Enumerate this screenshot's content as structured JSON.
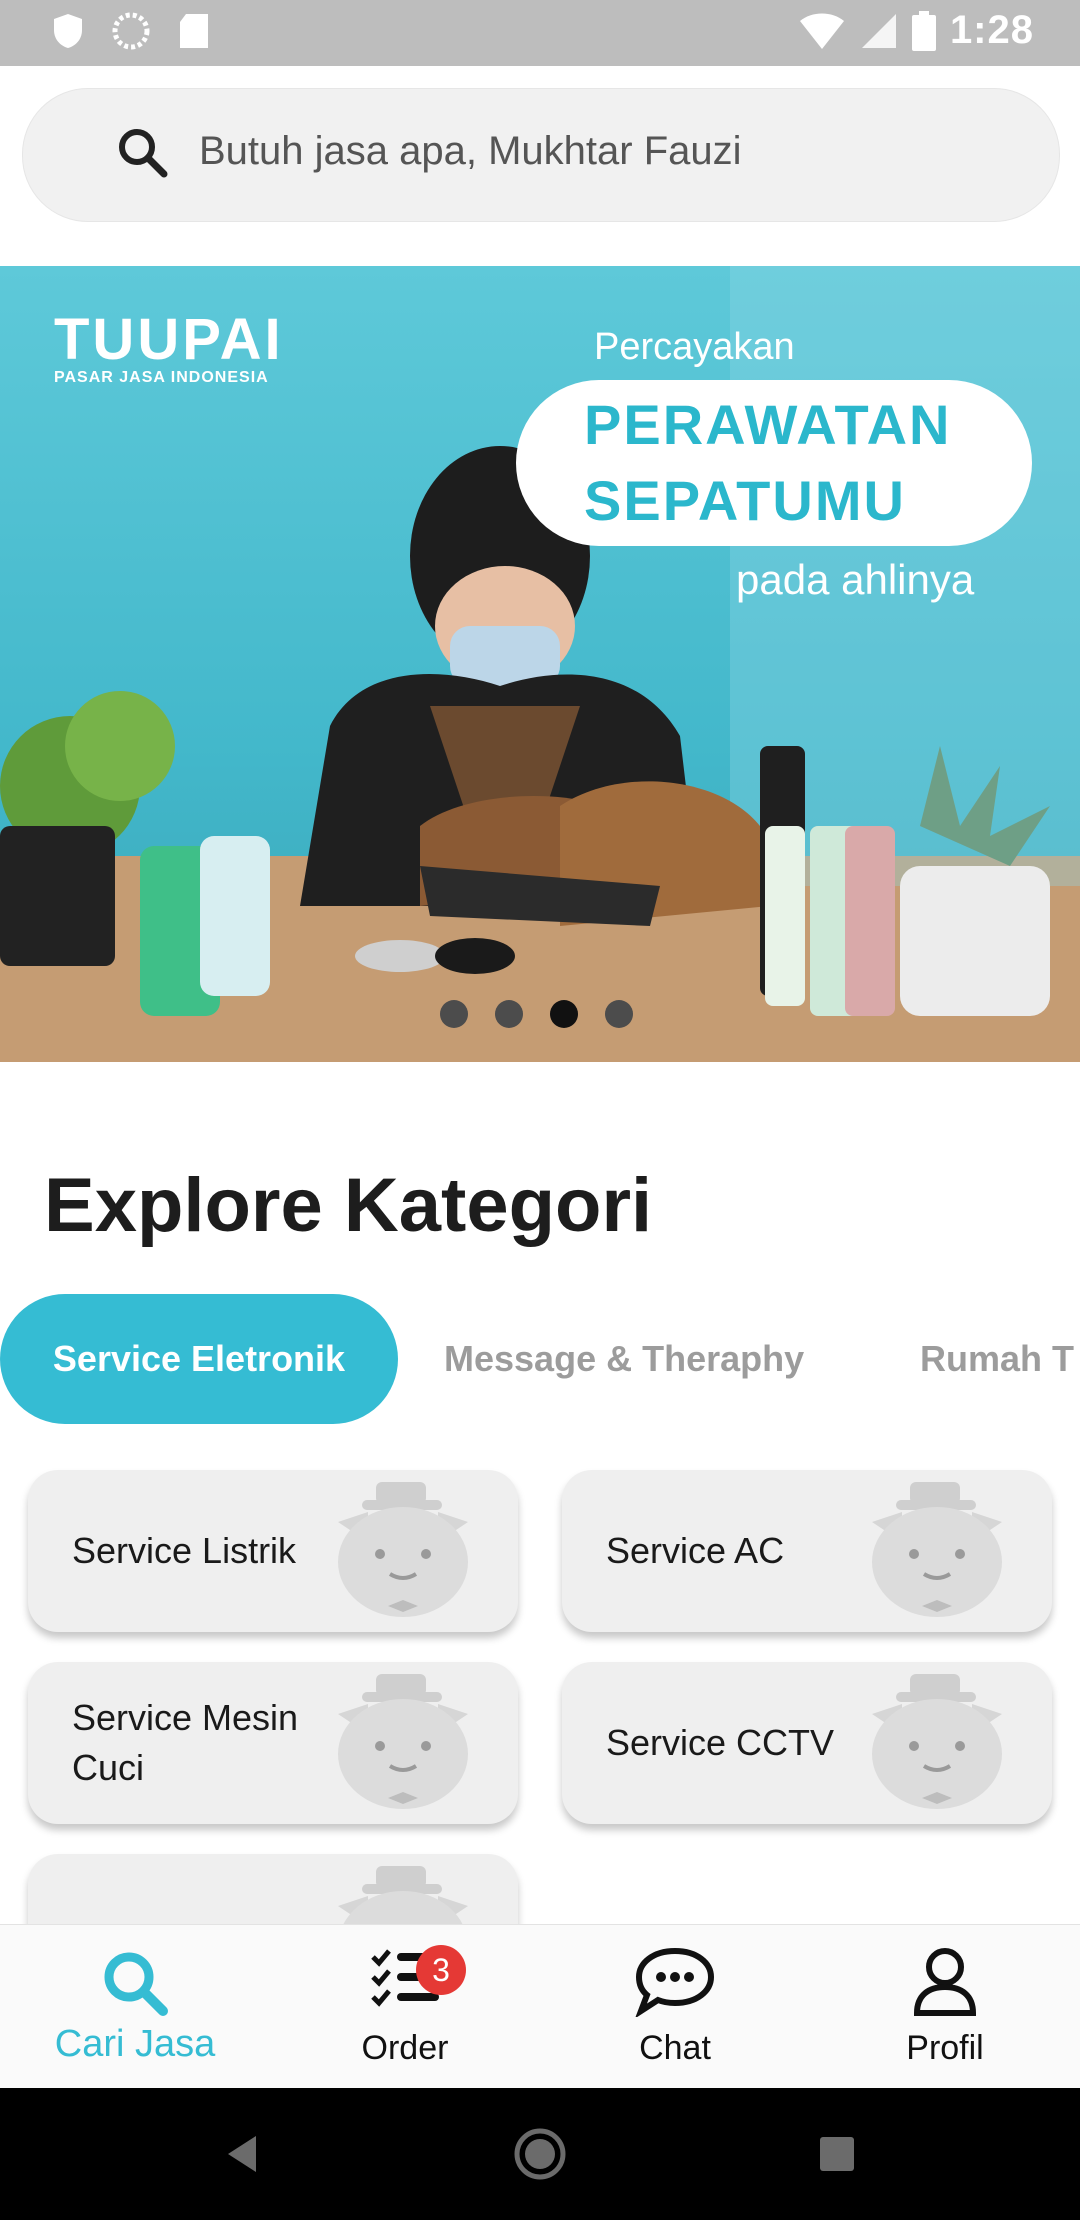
{
  "status_bar": {
    "time": "1:28"
  },
  "search": {
    "placeholder": "Butuh jasa apa, Mukhtar Fauzi"
  },
  "banner": {
    "brand_name": "TUUPAI",
    "brand_tagline": "PASAR JASA INDONESIA",
    "line_top": "Percayakan",
    "headline_1": "PERAWATAN",
    "headline_2": "SEPATUMU",
    "line_bottom": "pada ahlinya",
    "slide_count": 4,
    "active_slide": 3
  },
  "section_title": "Explore Kategori",
  "category_tabs": [
    {
      "label": "Service Eletronik",
      "active": true
    },
    {
      "label": "Message & Theraphy",
      "active": false
    },
    {
      "label": "Rumah T",
      "active": false
    }
  ],
  "services": [
    {
      "label": "Service Listrik"
    },
    {
      "label": "Service AC"
    },
    {
      "label": "Service Mesin Cuci"
    },
    {
      "label": "Service CCTV"
    }
  ],
  "bottom_nav": [
    {
      "label": "Cari Jasa",
      "icon": "search-icon",
      "active": true
    },
    {
      "label": "Order",
      "icon": "checklist-icon",
      "badge": "3"
    },
    {
      "label": "Chat",
      "icon": "chat-bubble-icon"
    },
    {
      "label": "Profil",
      "icon": "person-icon"
    }
  ],
  "colors": {
    "accent": "#35bcd3",
    "badge": "#e53935"
  }
}
